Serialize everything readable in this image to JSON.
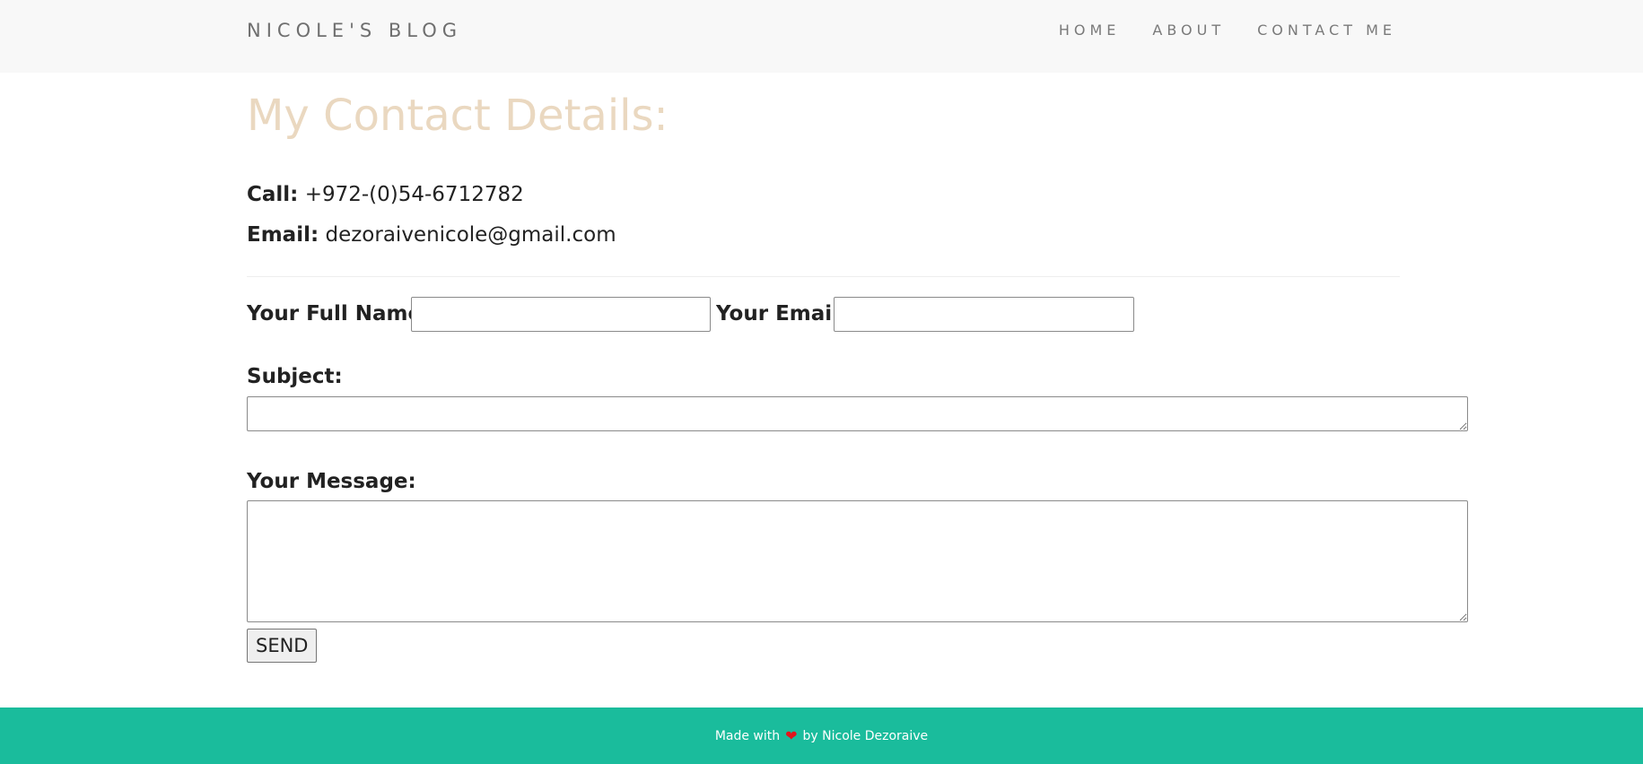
{
  "header": {
    "brand": "NICOLE'S BLOG",
    "nav": [
      "HOME",
      "ABOUT",
      "CONTACT ME"
    ]
  },
  "main": {
    "title": "My Contact Details:",
    "call_label": "Call:",
    "call_value": "+972-(0)54-6712782",
    "email_label": "Email:",
    "email_value": "dezoraivenicole@gmail.com"
  },
  "form": {
    "fullname_label": "Your Full Name:",
    "fullname_value": "",
    "email_label": "Your Email:",
    "email_value": "",
    "subject_label": "Subject:",
    "subject_value": "",
    "message_label": "Your Message:",
    "message_value": "",
    "send_label": "SEND"
  },
  "footer": {
    "made_with": "Made with",
    "by": "by Nicole Dezoraive",
    "icon": "heart-icon"
  },
  "colors": {
    "footer_bg": "#1abc9c",
    "title_color": "#ead8c0",
    "navbar_bg": "#f8f8f8",
    "heart": "#e2141b"
  }
}
